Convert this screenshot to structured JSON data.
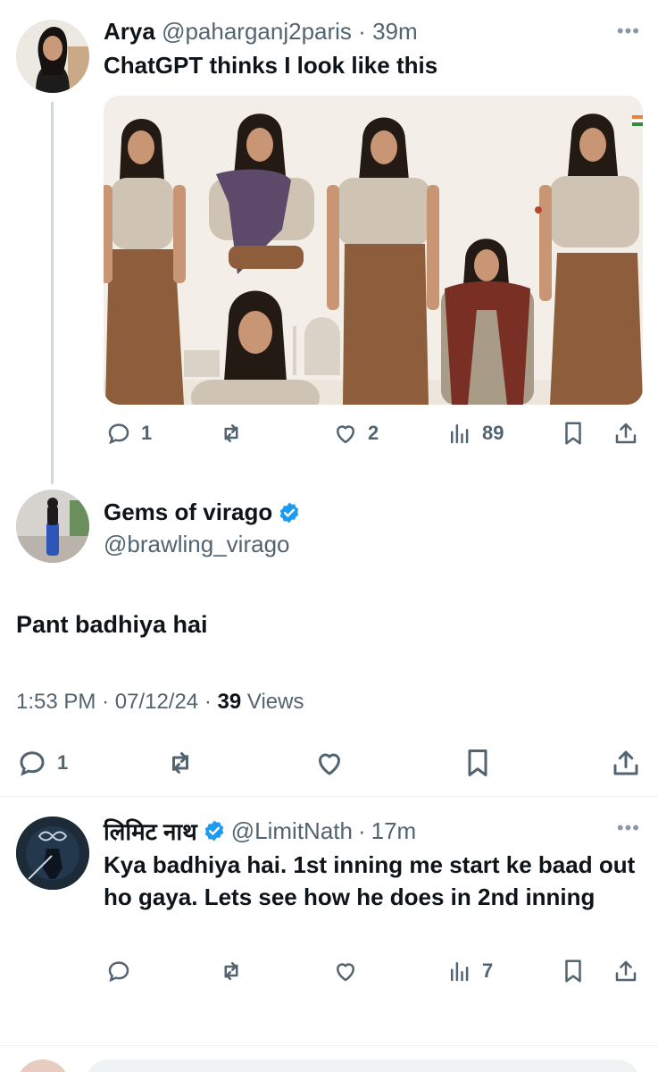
{
  "tweet1": {
    "name": "Arya",
    "handle": "@paharganj2paris",
    "separator": "·",
    "time": "39m",
    "text": "ChatGPT thinks I look like this",
    "more_icon": "more-horizontal-icon",
    "actions": {
      "replies": "1",
      "retweets": "",
      "likes": "2",
      "views": "89"
    }
  },
  "tweet2": {
    "name": "Gems of virago",
    "handle": "@brawling_virago",
    "text": "Pant badhiya hai",
    "time": "1:53 PM",
    "date": "07/12/24",
    "views_count": "39",
    "views_label": "Views",
    "separator": "·",
    "actions": {
      "replies": "1"
    },
    "verified_color": "#1d9bf0"
  },
  "tweet3": {
    "name": "लिमिट नाथ",
    "handle": "@LimitNath",
    "separator": "·",
    "time": "17m",
    "text": "Kya badhiya hai. 1st inning me start ke baad out ho gaya. Lets see how he does in 2nd inning",
    "actions": {
      "replies": "",
      "retweets": "",
      "likes": "",
      "views": "7"
    }
  },
  "colors": {
    "muted": "#536471",
    "accent": "#1d9bf0",
    "divider": "#eff3f4"
  }
}
